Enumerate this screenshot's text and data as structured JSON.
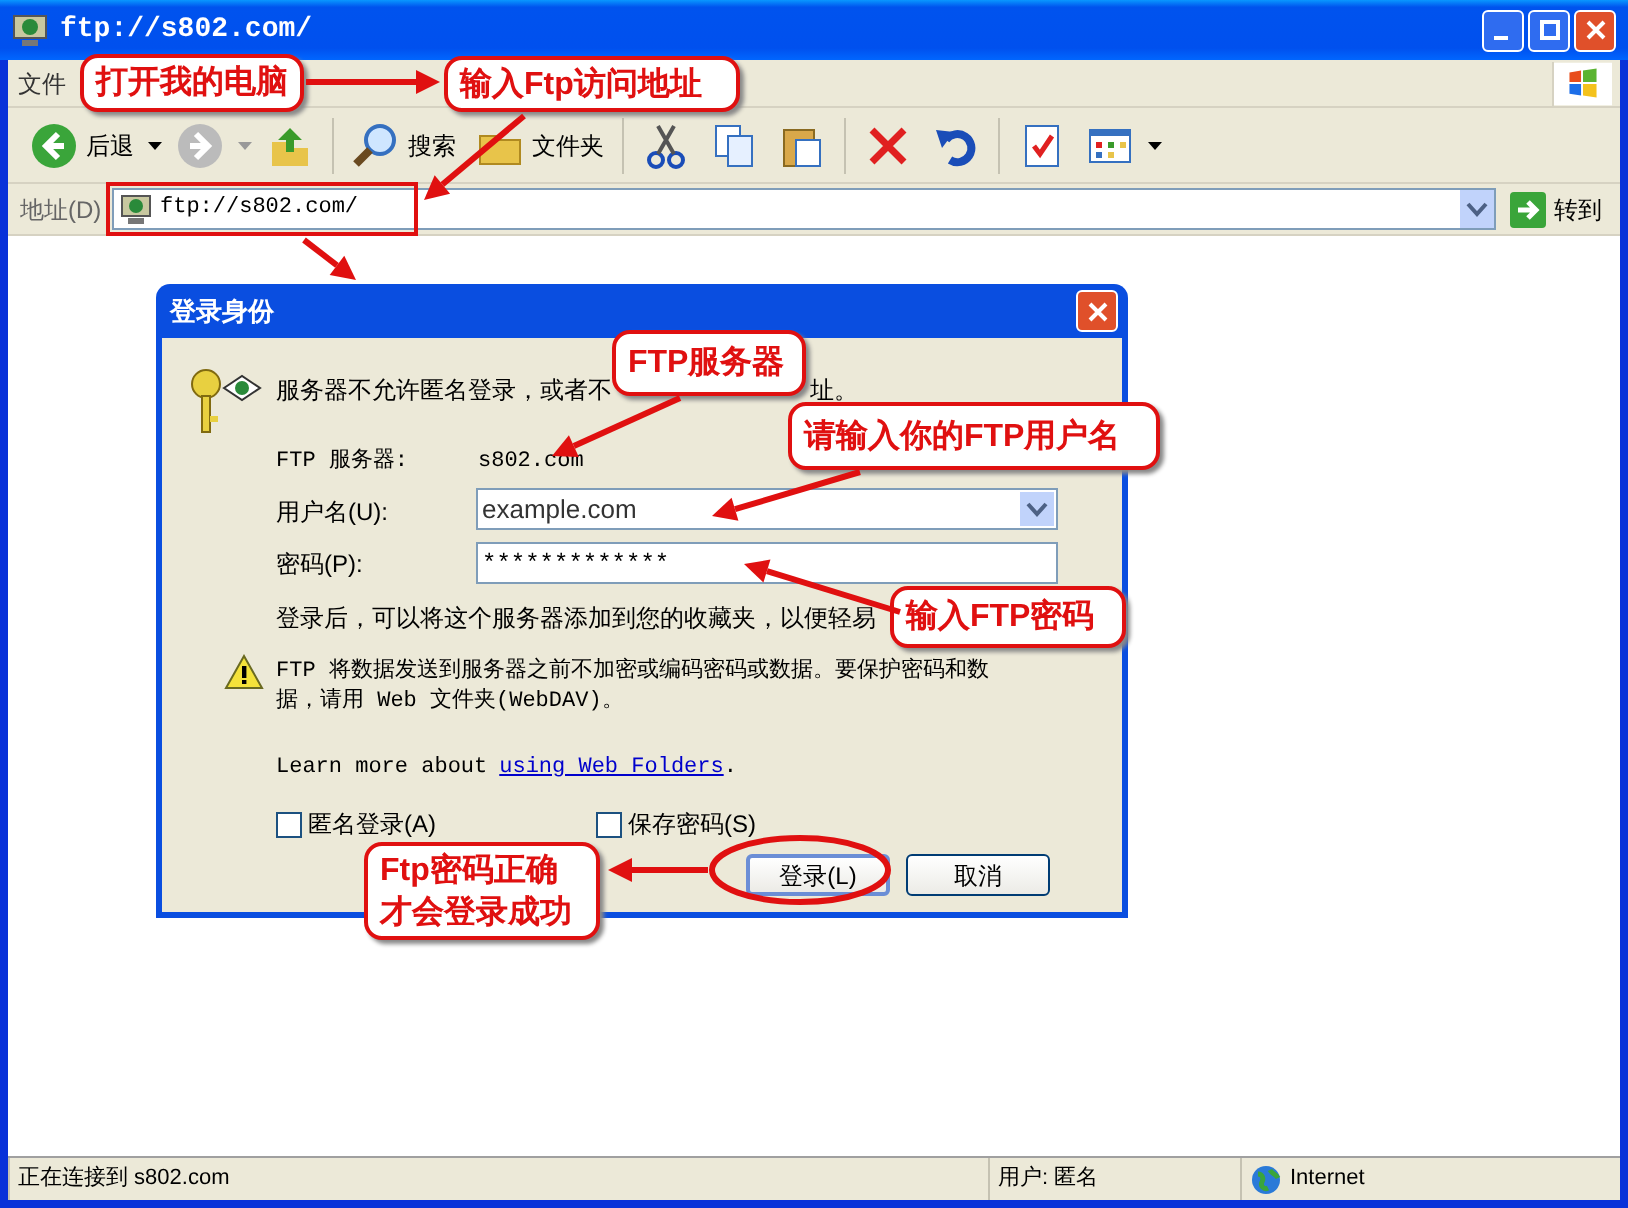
{
  "window": {
    "title": "ftp://s802.com/"
  },
  "menu": [
    "文件"
  ],
  "toolbar": [
    {
      "kind": "back",
      "label": "后退"
    },
    {
      "kind": "forward"
    },
    {
      "kind": "up"
    },
    {
      "kind": "search",
      "label": "搜索"
    },
    {
      "kind": "folders",
      "label": "文件夹"
    },
    {
      "kind": "cut"
    },
    {
      "kind": "copy"
    },
    {
      "kind": "paste"
    },
    {
      "kind": "delete"
    },
    {
      "kind": "undo"
    },
    {
      "kind": "properties"
    },
    {
      "kind": "views"
    }
  ],
  "address_bar": {
    "label": "地址(D)",
    "value": "ftp://s802.com/",
    "go": "转到"
  },
  "dialog": {
    "title": "登录身份",
    "message_parts": [
      "服务器不允许匿名登录，或者不",
      "址。"
    ],
    "server_label": "FTP 服务器:",
    "server": "s802.com",
    "username_label": "用户名(U):",
    "username": "example.com",
    "password_label": "密码(P):",
    "password": "*************",
    "hint": "登录后，可以将这个服务器添加到您的收藏夹，以便轻易",
    "warning_lines": [
      "FTP 将数据发送到服务器之前不加密或编码密码或数据。要保护密码和数",
      "据，请用 Web 文件夹(WebDAV)。"
    ],
    "learn_more": "Learn more about",
    "link": "using Web Folders",
    "learn_more_end": ".",
    "checkboxes": [
      {
        "label": "匿名登录(A)",
        "checked": false
      },
      {
        "label": "保存密码(S)",
        "checked": false
      }
    ],
    "buttons": [
      {
        "label": "登录(L)",
        "default": true
      },
      {
        "label": "取消",
        "default": false
      }
    ]
  },
  "status_bar": [
    "正在连接到 s802.com",
    "用户: 匿名",
    "Internet"
  ],
  "annotations": [
    {
      "lines": [
        "打开我的电脑"
      ]
    },
    {
      "lines": [
        "输入Ftp访问地址"
      ]
    },
    {
      "lines": [
        "FTP服务器"
      ]
    },
    {
      "lines": [
        "请输入你的FTP用户名"
      ]
    },
    {
      "lines": [
        "输入FTP密码"
      ]
    },
    {
      "lines": [
        "Ftp密码正确",
        "才会登录成功"
      ]
    }
  ]
}
